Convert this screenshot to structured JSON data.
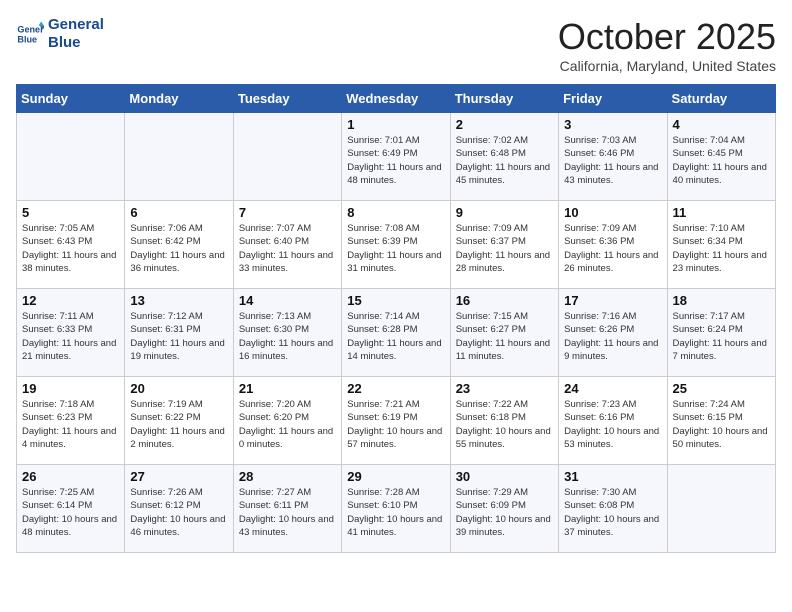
{
  "logo": {
    "line1": "General",
    "line2": "Blue"
  },
  "title": "October 2025",
  "subtitle": "California, Maryland, United States",
  "weekdays": [
    "Sunday",
    "Monday",
    "Tuesday",
    "Wednesday",
    "Thursday",
    "Friday",
    "Saturday"
  ],
  "weeks": [
    [
      {
        "day": "",
        "info": ""
      },
      {
        "day": "",
        "info": ""
      },
      {
        "day": "",
        "info": ""
      },
      {
        "day": "1",
        "info": "Sunrise: 7:01 AM\nSunset: 6:49 PM\nDaylight: 11 hours\nand 48 minutes."
      },
      {
        "day": "2",
        "info": "Sunrise: 7:02 AM\nSunset: 6:48 PM\nDaylight: 11 hours\nand 45 minutes."
      },
      {
        "day": "3",
        "info": "Sunrise: 7:03 AM\nSunset: 6:46 PM\nDaylight: 11 hours\nand 43 minutes."
      },
      {
        "day": "4",
        "info": "Sunrise: 7:04 AM\nSunset: 6:45 PM\nDaylight: 11 hours\nand 40 minutes."
      }
    ],
    [
      {
        "day": "5",
        "info": "Sunrise: 7:05 AM\nSunset: 6:43 PM\nDaylight: 11 hours\nand 38 minutes."
      },
      {
        "day": "6",
        "info": "Sunrise: 7:06 AM\nSunset: 6:42 PM\nDaylight: 11 hours\nand 36 minutes."
      },
      {
        "day": "7",
        "info": "Sunrise: 7:07 AM\nSunset: 6:40 PM\nDaylight: 11 hours\nand 33 minutes."
      },
      {
        "day": "8",
        "info": "Sunrise: 7:08 AM\nSunset: 6:39 PM\nDaylight: 11 hours\nand 31 minutes."
      },
      {
        "day": "9",
        "info": "Sunrise: 7:09 AM\nSunset: 6:37 PM\nDaylight: 11 hours\nand 28 minutes."
      },
      {
        "day": "10",
        "info": "Sunrise: 7:09 AM\nSunset: 6:36 PM\nDaylight: 11 hours\nand 26 minutes."
      },
      {
        "day": "11",
        "info": "Sunrise: 7:10 AM\nSunset: 6:34 PM\nDaylight: 11 hours\nand 23 minutes."
      }
    ],
    [
      {
        "day": "12",
        "info": "Sunrise: 7:11 AM\nSunset: 6:33 PM\nDaylight: 11 hours\nand 21 minutes."
      },
      {
        "day": "13",
        "info": "Sunrise: 7:12 AM\nSunset: 6:31 PM\nDaylight: 11 hours\nand 19 minutes."
      },
      {
        "day": "14",
        "info": "Sunrise: 7:13 AM\nSunset: 6:30 PM\nDaylight: 11 hours\nand 16 minutes."
      },
      {
        "day": "15",
        "info": "Sunrise: 7:14 AM\nSunset: 6:28 PM\nDaylight: 11 hours\nand 14 minutes."
      },
      {
        "day": "16",
        "info": "Sunrise: 7:15 AM\nSunset: 6:27 PM\nDaylight: 11 hours\nand 11 minutes."
      },
      {
        "day": "17",
        "info": "Sunrise: 7:16 AM\nSunset: 6:26 PM\nDaylight: 11 hours\nand 9 minutes."
      },
      {
        "day": "18",
        "info": "Sunrise: 7:17 AM\nSunset: 6:24 PM\nDaylight: 11 hours\nand 7 minutes."
      }
    ],
    [
      {
        "day": "19",
        "info": "Sunrise: 7:18 AM\nSunset: 6:23 PM\nDaylight: 11 hours\nand 4 minutes."
      },
      {
        "day": "20",
        "info": "Sunrise: 7:19 AM\nSunset: 6:22 PM\nDaylight: 11 hours\nand 2 minutes."
      },
      {
        "day": "21",
        "info": "Sunrise: 7:20 AM\nSunset: 6:20 PM\nDaylight: 11 hours\nand 0 minutes."
      },
      {
        "day": "22",
        "info": "Sunrise: 7:21 AM\nSunset: 6:19 PM\nDaylight: 10 hours\nand 57 minutes."
      },
      {
        "day": "23",
        "info": "Sunrise: 7:22 AM\nSunset: 6:18 PM\nDaylight: 10 hours\nand 55 minutes."
      },
      {
        "day": "24",
        "info": "Sunrise: 7:23 AM\nSunset: 6:16 PM\nDaylight: 10 hours\nand 53 minutes."
      },
      {
        "day": "25",
        "info": "Sunrise: 7:24 AM\nSunset: 6:15 PM\nDaylight: 10 hours\nand 50 minutes."
      }
    ],
    [
      {
        "day": "26",
        "info": "Sunrise: 7:25 AM\nSunset: 6:14 PM\nDaylight: 10 hours\nand 48 minutes."
      },
      {
        "day": "27",
        "info": "Sunrise: 7:26 AM\nSunset: 6:12 PM\nDaylight: 10 hours\nand 46 minutes."
      },
      {
        "day": "28",
        "info": "Sunrise: 7:27 AM\nSunset: 6:11 PM\nDaylight: 10 hours\nand 43 minutes."
      },
      {
        "day": "29",
        "info": "Sunrise: 7:28 AM\nSunset: 6:10 PM\nDaylight: 10 hours\nand 41 minutes."
      },
      {
        "day": "30",
        "info": "Sunrise: 7:29 AM\nSunset: 6:09 PM\nDaylight: 10 hours\nand 39 minutes."
      },
      {
        "day": "31",
        "info": "Sunrise: 7:30 AM\nSunset: 6:08 PM\nDaylight: 10 hours\nand 37 minutes."
      },
      {
        "day": "",
        "info": ""
      }
    ]
  ]
}
